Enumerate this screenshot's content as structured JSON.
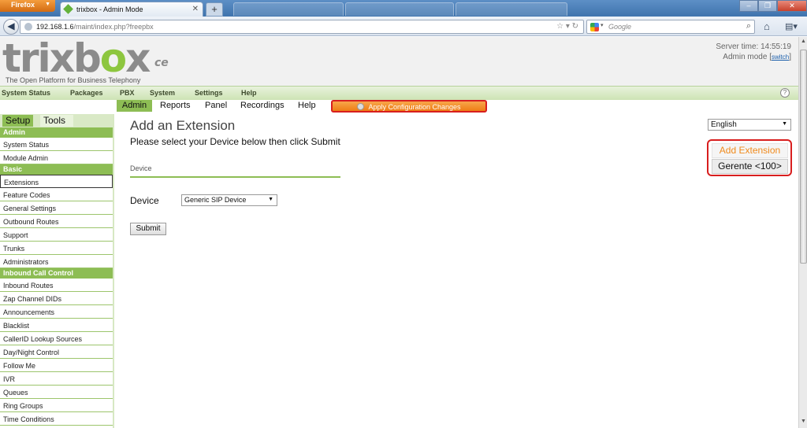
{
  "browser": {
    "menu_button": "Firefox",
    "tab_title": "trixbox - Admin Mode",
    "new_tab": "+",
    "url_host": "192.168.1.6",
    "url_path": "/maint/index.php?freepbx",
    "search_placeholder": "Google",
    "window_controls": {
      "minimize": "–",
      "maximize": "❐",
      "close": "✕"
    }
  },
  "header": {
    "logo_text_a": "trixb",
    "logo_text_o": "o",
    "logo_text_b": "x",
    "logo_suffix": "ce",
    "tagline": "The Open Platform for Business Telephony",
    "server_time": "Server time: 14:55:19",
    "mode": "Admin mode",
    "switch": "switch"
  },
  "top_menu": [
    "System Status",
    "Packages",
    "PBX",
    "System",
    "Settings",
    "Help"
  ],
  "sub_nav": {
    "items": [
      "Admin",
      "Reports",
      "Panel",
      "Recordings",
      "Help"
    ],
    "apply_button": "Apply Configuration Changes"
  },
  "sidebar": {
    "tabs": [
      "Setup",
      "Tools"
    ],
    "sections": [
      {
        "title": "Admin",
        "items": [
          "System Status",
          "Module Admin"
        ]
      },
      {
        "title": "Basic",
        "items": [
          "Extensions",
          "Feature Codes",
          "General Settings",
          "Outbound Routes",
          "Support",
          "Trunks",
          "Administrators"
        ]
      },
      {
        "title": "Inbound Call Control",
        "items": [
          "Inbound Routes",
          "Zap Channel DIDs",
          "Announcements",
          "Blacklist",
          "CallerID Lookup Sources",
          "Day/Night Control",
          "Follow Me",
          "IVR",
          "Queues",
          "Ring Groups",
          "Time Conditions"
        ]
      }
    ]
  },
  "main": {
    "title": "Add an Extension",
    "subtitle": "Please select your Device below then click Submit",
    "fieldset_label": "Device",
    "device_label": "Device",
    "device_value": "Generic SIP Device",
    "submit_label": "Submit",
    "language_value": "English",
    "ext_box": {
      "add_label": "Add Extension",
      "extension": "Gerente <100>"
    }
  },
  "colors": {
    "accent_green": "#8dbd54",
    "apply_orange": "#f08a1c",
    "highlight_red": "#d81e1e"
  }
}
